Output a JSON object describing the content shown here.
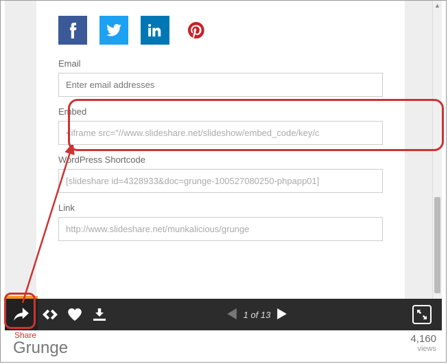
{
  "labels": {
    "email": "Email",
    "embed": "Embed",
    "wordpress": "WordPress Shortcode",
    "link": "Link"
  },
  "placeholders": {
    "email": "Enter email addresses",
    "embed": "<iframe src=\"//www.slideshare.net/slideshow/embed_code/key/c",
    "wordpress": "[slideshare id=4328933&doc=grunge-100527080250-phpapp01]",
    "link": "http://www.slideshare.net/munkalicious/grunge"
  },
  "toolbar": {
    "pager": "1 of 13"
  },
  "footer": {
    "share_label": "Share",
    "title": "Grunge",
    "views_count": "4,160",
    "views_label": "views"
  }
}
